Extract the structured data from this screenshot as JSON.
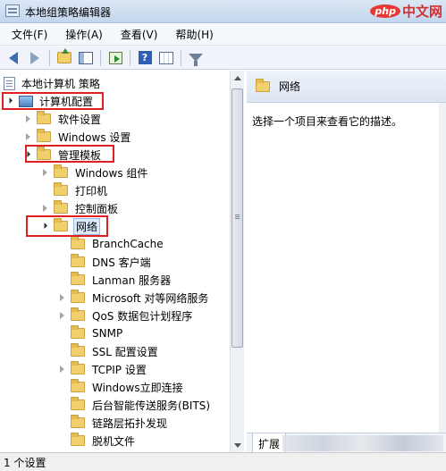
{
  "window": {
    "title": "本地组策略编辑器"
  },
  "watermark": {
    "badge": "php",
    "text": "中文网"
  },
  "menu": [
    {
      "label": "文件(F)"
    },
    {
      "label": "操作(A)"
    },
    {
      "label": "查看(V)"
    },
    {
      "label": "帮助(H)"
    }
  ],
  "toolbar": {
    "icons": [
      "back-arrow-icon",
      "forward-arrow-icon",
      "up-folder-icon",
      "show-pane-icon",
      "export-icon",
      "help-icon",
      "properties-grid-icon",
      "filter-icon"
    ]
  },
  "tree": {
    "root": "本地计算机 策略",
    "computer_config": "计算机配置",
    "software_settings": "软件设置",
    "windows_settings": "Windows 设置",
    "admin_templates": "管理模板",
    "windows_components": "Windows 组件",
    "printers": "打印机",
    "control_panel": "控制面板",
    "network": "网络",
    "network_children": [
      "BranchCache",
      "DNS 客户端",
      "Lanman 服务器",
      "Microsoft 对等网络服务",
      "QoS 数据包计划程序",
      "SNMP",
      "SSL 配置设置",
      "TCPIP 设置",
      "Windows立即连接",
      "后台智能传送服务(BITS)",
      "链路层拓扑发现",
      "脱机文件"
    ]
  },
  "right_pane": {
    "header_title": "网络",
    "description": "选择一个项目来查看它的描述。",
    "tab_expand": "扩展"
  },
  "status": {
    "text": "1 个设置"
  },
  "colors": {
    "highlight": "#e02020",
    "selection": "#dceafc",
    "folder": "#f1cf6d"
  }
}
